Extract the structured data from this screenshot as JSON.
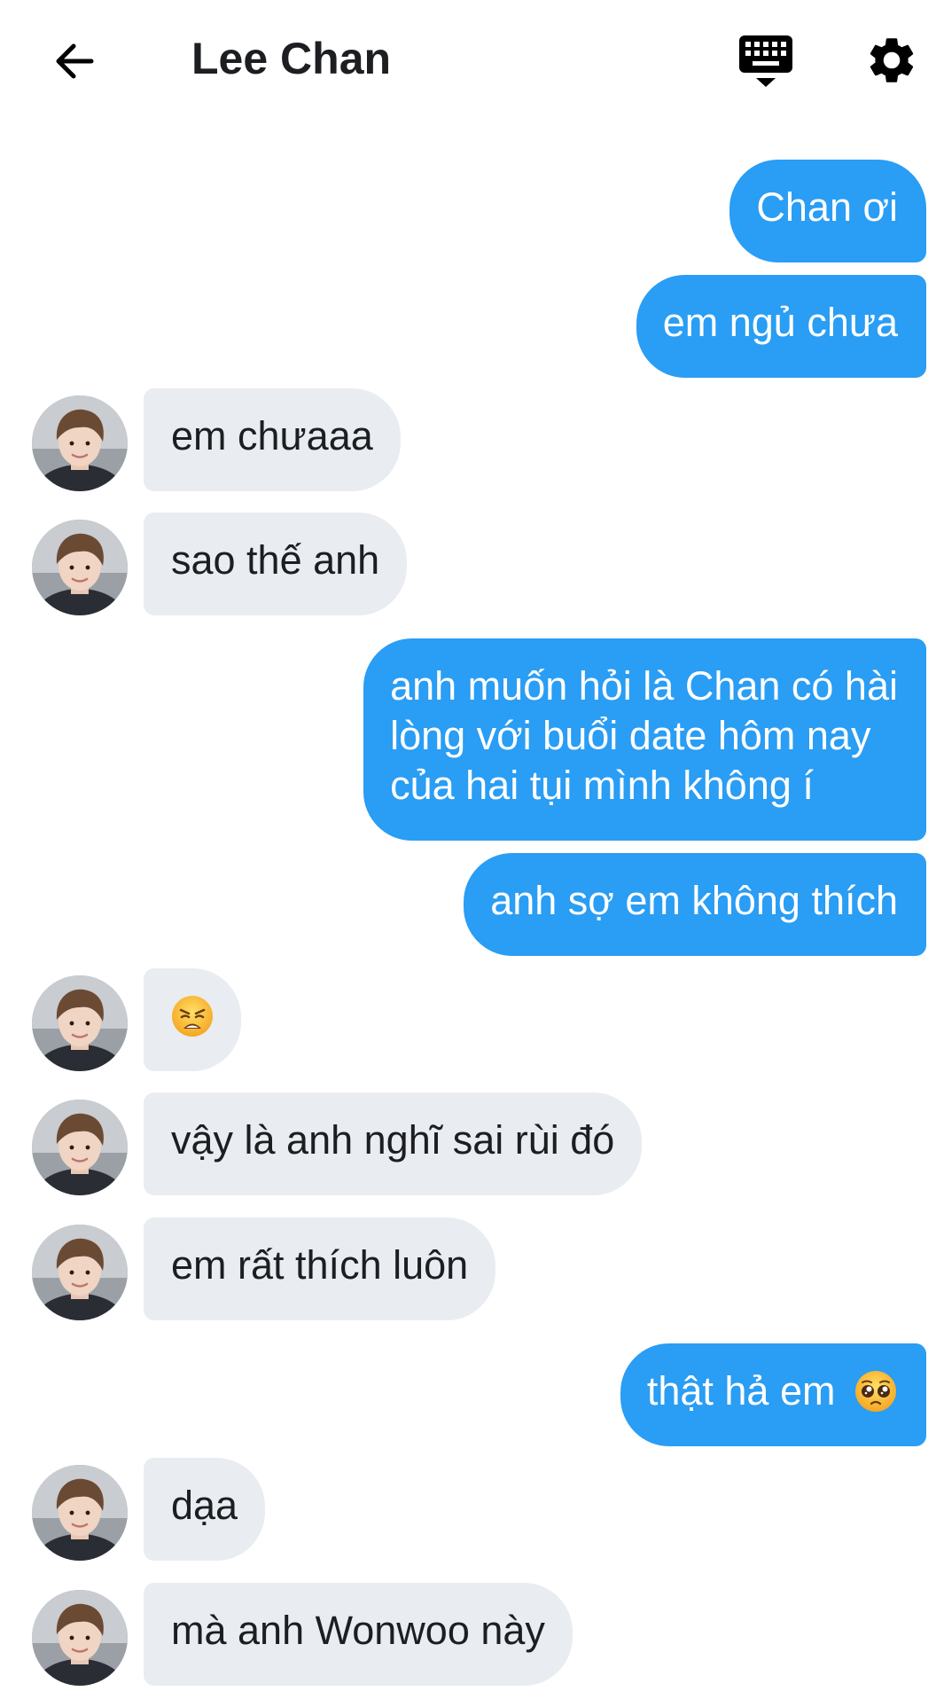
{
  "header": {
    "title": "Lee Chan",
    "back_icon": "arrow-left-icon",
    "keyboard_icon": "keyboard-hide-icon",
    "settings_icon": "gear-icon"
  },
  "colors": {
    "outgoing_bubble": "#2a9df4",
    "incoming_bubble": "#e9ecf0",
    "text_dark": "#1c1e21"
  },
  "messages": [
    {
      "direction": "out",
      "text": "Chan ơi"
    },
    {
      "direction": "out",
      "text": "em ngủ chưa"
    },
    {
      "direction": "in",
      "text": "em chưaaa"
    },
    {
      "direction": "in",
      "text": "sao thế anh"
    },
    {
      "direction": "out",
      "lines": [
        "anh muốn hỏi là Chan có hài",
        "lòng với buổi date hôm nay",
        "của hai tụi mình không í"
      ]
    },
    {
      "direction": "out",
      "text": "anh sợ em không thích"
    },
    {
      "direction": "in",
      "emoji": "weary-face-emoji"
    },
    {
      "direction": "in",
      "text": "vậy là anh nghĩ sai rùi đó"
    },
    {
      "direction": "in",
      "text": "em rất thích luôn"
    },
    {
      "direction": "out",
      "text": "thật hả em",
      "emoji": "pleading-face-emoji"
    },
    {
      "direction": "in",
      "text": "dạa"
    },
    {
      "direction": "in",
      "text": "mà anh Wonwoo này"
    }
  ]
}
